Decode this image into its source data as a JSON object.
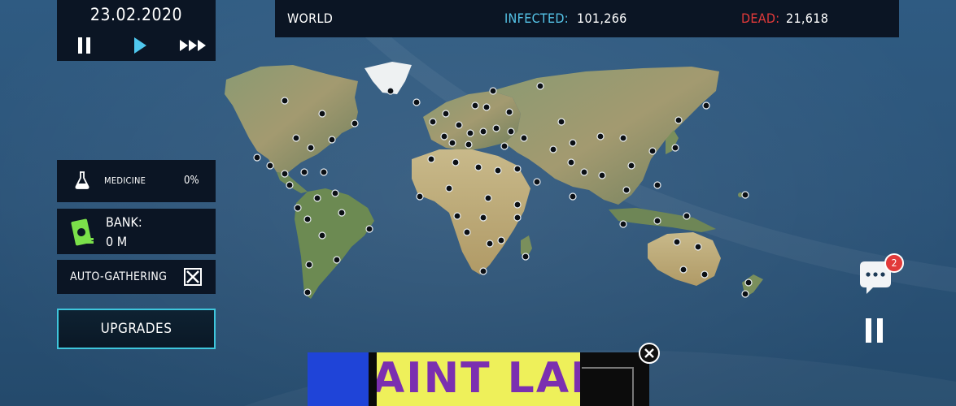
{
  "game": {
    "date": "23.02.2020",
    "speed_controls": {
      "pause_icon": "pause-icon",
      "play_icon": "play-icon",
      "fast_forward_icon": "fast-forward-icon"
    }
  },
  "stats": {
    "region": "WORLD",
    "infected_label": "INFECTED:",
    "infected_value": "101,266",
    "dead_label": "DEAD:",
    "dead_value": "21,618"
  },
  "medicine": {
    "label": "MEDICINE",
    "value": "0%"
  },
  "bank": {
    "label": "BANK:",
    "value": "0 M"
  },
  "auto_gathering": {
    "label": "AUTO-GATHERING",
    "checked": false
  },
  "upgrades": {
    "label": "UPGRADES"
  },
  "chat": {
    "badge_count": "2"
  },
  "ad": {
    "text": "AINT LAN"
  },
  "colors": {
    "panel_bg": "#0b1524",
    "infected": "#55c4e8",
    "dead": "#e23a3a",
    "upgrades_border": "#3ec6dc",
    "badge": "#e23a3a",
    "ad_blue": "#1f44d8",
    "ad_yellow": "#eef05a",
    "ad_purple": "#7b2fb0"
  }
}
